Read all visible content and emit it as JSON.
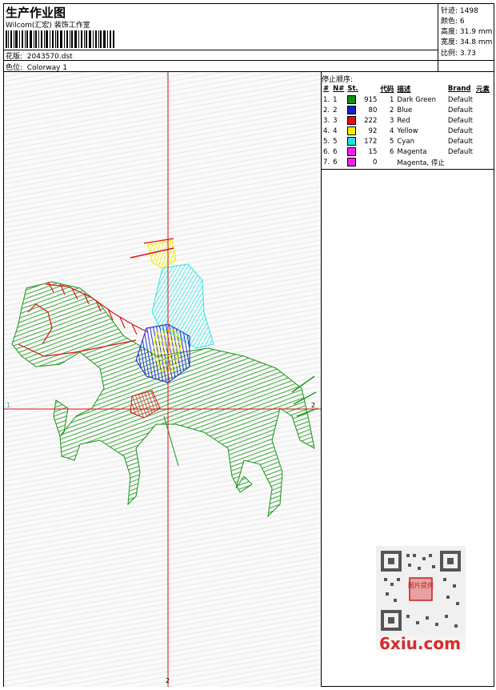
{
  "header": {
    "title": "生产作业图",
    "studio": "Wilcom(汇宏) 装饰工作室",
    "design_label": "花版:",
    "design_value": "2043570.dst",
    "colorway_label": "色位:",
    "colorway_value": "Colorway 1"
  },
  "stats": [
    {
      "label": "针迹:",
      "value": "1498"
    },
    {
      "label": "颜色:",
      "value": "6"
    },
    {
      "label": "高度:",
      "value": "31.9 mm"
    },
    {
      "label": "宽度:",
      "value": "34.8 mm"
    },
    {
      "label": "比例:",
      "value": "3.73"
    }
  ],
  "stop_sequence": {
    "title": "停止顺序:",
    "columns": [
      "#",
      "N#",
      "St.",
      "代码",
      "描述",
      "Brand",
      "元素"
    ],
    "rows": [
      {
        "num": "1.",
        "n": "1",
        "color": "#109010",
        "st": "915",
        "code": "1",
        "desc": "Dark Green",
        "brand": "Default"
      },
      {
        "num": "2.",
        "n": "2",
        "color": "#1020d0",
        "st": "80",
        "code": "2",
        "desc": "Blue",
        "brand": "Default"
      },
      {
        "num": "3.",
        "n": "3",
        "color": "#e01010",
        "st": "222",
        "code": "3",
        "desc": "Red",
        "brand": "Default"
      },
      {
        "num": "4.",
        "n": "4",
        "color": "#f0f000",
        "st": "92",
        "code": "4",
        "desc": "Yellow",
        "brand": "Default"
      },
      {
        "num": "5.",
        "n": "5",
        "color": "#20e0e0",
        "st": "172",
        "code": "5",
        "desc": "Cyan",
        "brand": "Default"
      },
      {
        "num": "6.",
        "n": "6",
        "color": "#f020f0",
        "st": "15",
        "code": "6",
        "desc": "Magenta",
        "brand": "Default"
      },
      {
        "num": "7.",
        "n": "6",
        "color": "#f020f0",
        "st": "0",
        "code": "",
        "desc": "Magenta, 停止",
        "brand": ""
      }
    ]
  },
  "axes": {
    "top": "1",
    "bottom": "2",
    "left": "1",
    "right": "2"
  },
  "watermark": {
    "site": "6xiu.com",
    "seal": "图片提供"
  }
}
